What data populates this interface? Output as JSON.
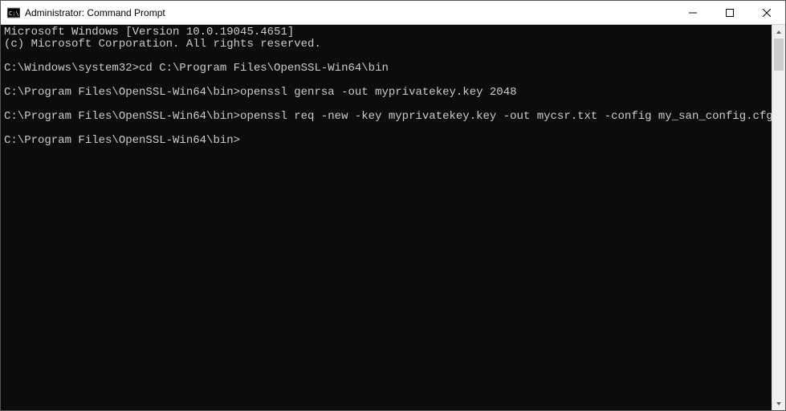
{
  "window": {
    "title": "Administrator: Command Prompt"
  },
  "terminal": {
    "lines": [
      "Microsoft Windows [Version 10.0.19045.4651]",
      "(c) Microsoft Corporation. All rights reserved.",
      "",
      "C:\\Windows\\system32>cd C:\\Program Files\\OpenSSL-Win64\\bin",
      "",
      "C:\\Program Files\\OpenSSL-Win64\\bin>openssl genrsa -out myprivatekey.key 2048",
      "",
      "C:\\Program Files\\OpenSSL-Win64\\bin>openssl req -new -key myprivatekey.key -out mycsr.txt -config my_san_config.cfg",
      "",
      "C:\\Program Files\\OpenSSL-Win64\\bin>"
    ]
  }
}
